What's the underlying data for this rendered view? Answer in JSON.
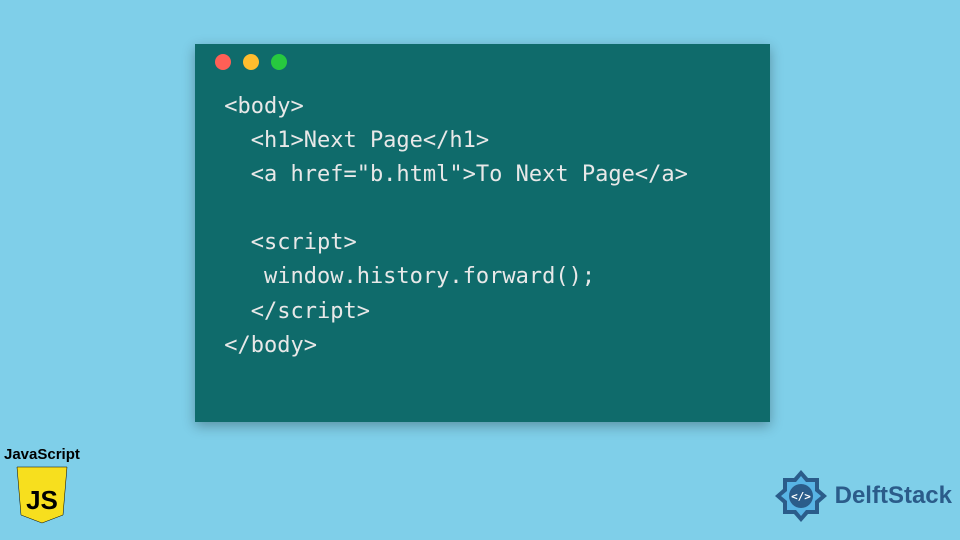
{
  "code": {
    "lines": [
      " <body>",
      "   <h1>Next Page</h1>",
      "   <a href=\"b.html\">To Next Page</a>",
      "",
      "   <script>",
      "    window.history.forward();",
      "   </script>",
      " </body>"
    ]
  },
  "window": {
    "dot_colors": {
      "red": "#ff5f56",
      "yellow": "#ffbd2e",
      "green": "#27c93f"
    }
  },
  "branding": {
    "js_label": "JavaScript",
    "js_shield_text": "JS",
    "delft_text": "DelftStack",
    "delft_code_symbol": "</>"
  },
  "colors": {
    "page_bg": "#7fcfe9",
    "window_bg": "#0f6b6b",
    "code_fg": "#e8e8e8",
    "js_shield": "#f7df1e",
    "delft_blue": "#2b5c8a"
  }
}
